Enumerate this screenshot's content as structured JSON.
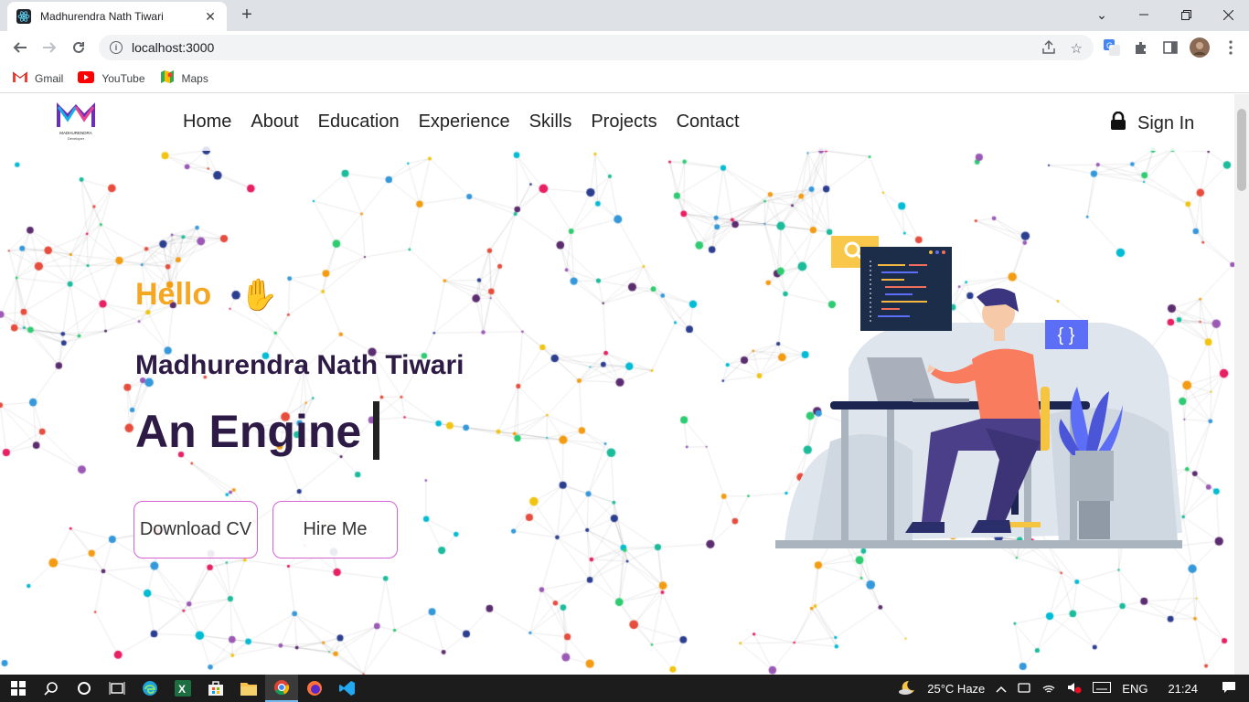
{
  "browser": {
    "tab_title": "Madhurendra Nath Tiwari",
    "tab_close": "✕",
    "new_tab": "+",
    "url": "localhost:3000",
    "bookmarks": [
      {
        "label": "Gmail",
        "icon": "gmail-icon"
      },
      {
        "label": "YouTube",
        "icon": "youtube-icon"
      },
      {
        "label": "Maps",
        "icon": "maps-icon"
      }
    ]
  },
  "site": {
    "logo_text": "MADHURENDRA",
    "logo_sub": "Developer",
    "nav": [
      "Home",
      "About",
      "Education",
      "Experience",
      "Skills",
      "Projects",
      "Contact"
    ],
    "signin": "Sign In",
    "hello": "Hello",
    "hand": "✋",
    "name": "Madhurendra Nath Tiwari",
    "typed": "An Engine",
    "buttons": {
      "download": "Download CV",
      "hire": "Hire Me"
    },
    "braces": "{ }"
  },
  "taskbar": {
    "weather": "25°C  Haze",
    "lang": "ENG",
    "time": "21:24"
  },
  "colors": {
    "accent": "#f5a623",
    "heading": "#2d1a45",
    "button_border": "#d563d6"
  }
}
